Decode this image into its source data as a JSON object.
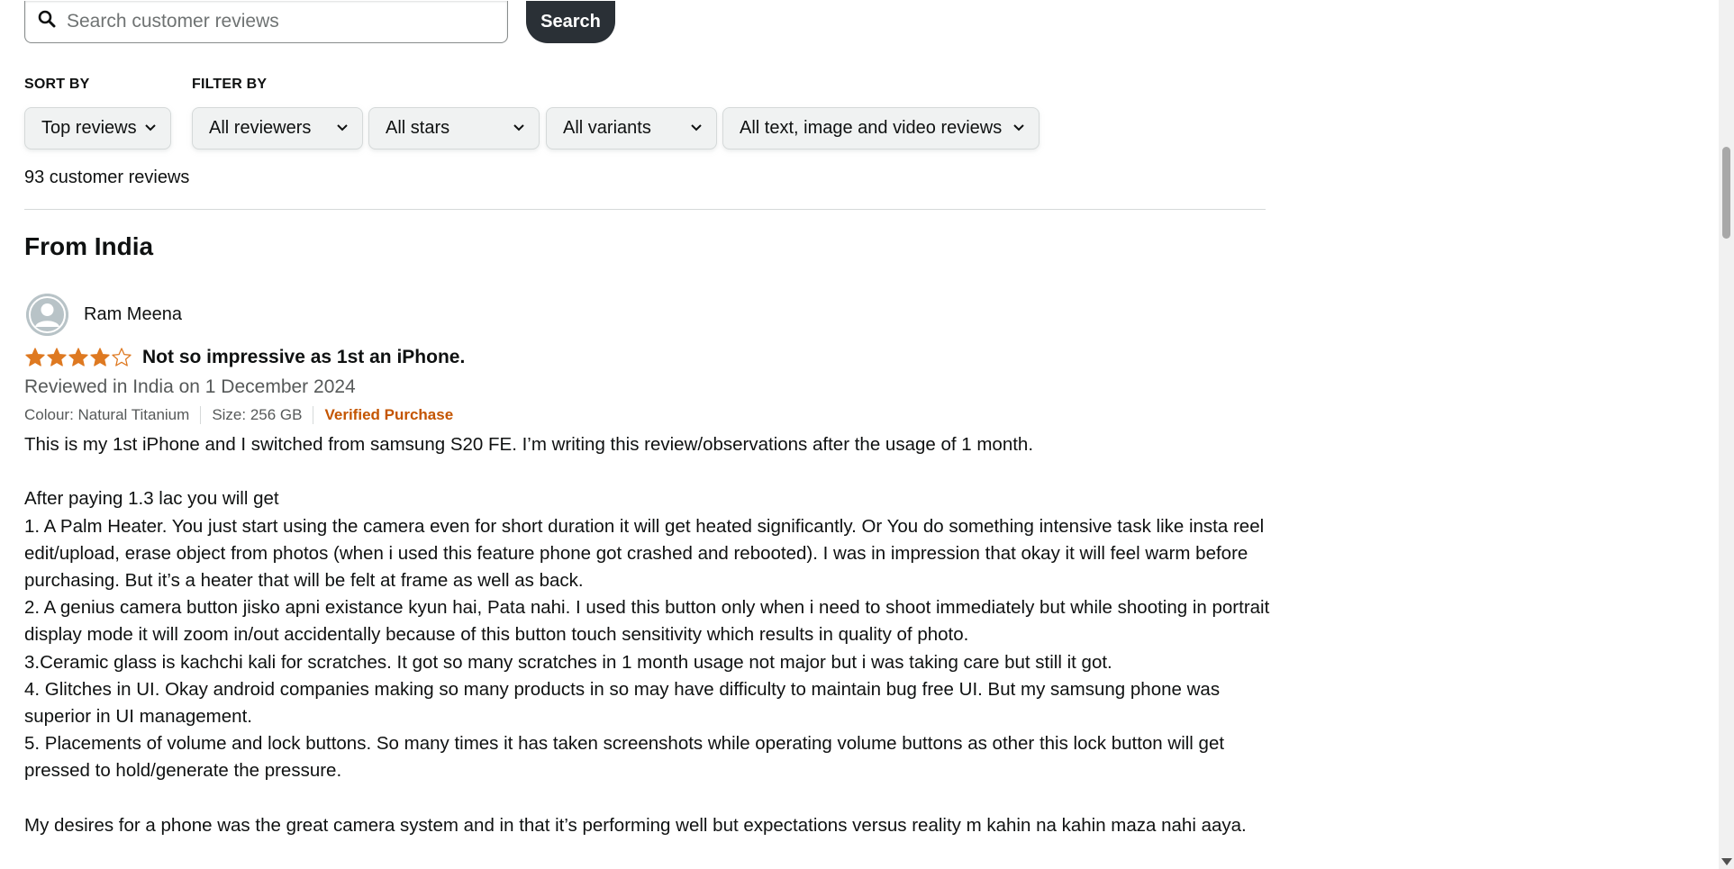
{
  "search": {
    "placeholder": "Search customer reviews",
    "button_label": "Search"
  },
  "sort": {
    "label": "SORT BY",
    "selected": "Top reviews"
  },
  "filter": {
    "label": "FILTER BY",
    "reviewers": "All reviewers",
    "stars": "All stars",
    "variants": "All variants",
    "media": "All text, image and video reviews"
  },
  "review_count": "93 customer reviews",
  "section_title": "From India",
  "review": {
    "reviewer_name": "Ram Meena",
    "rating": 4,
    "rating_max": 5,
    "title": "Not so impressive as 1st an iPhone.",
    "date": "Reviewed in India on 1 December 2024",
    "colour": "Colour: Natural Titanium",
    "size": "Size: 256 GB",
    "verified": "Verified Purchase",
    "body": "This is my 1st iPhone and I switched from samsung S20 FE. I’m writing this review/observations after the usage of 1 month.\n\nAfter paying 1.3 lac you will get\n1. A Palm Heater. You just start using the camera even for short duration it will get heated significantly. Or You do something intensive task like insta reel edit/upload, erase object from photos (when i used this feature phone got crashed and rebooted). I was in impression that okay it will feel warm before purchasing. But it’s a heater that will be felt at frame as well as back.\n2. A genius camera button jisko apni existance kyun hai, Pata nahi. I used this button only when i need to shoot immediately but while shooting in portrait display mode it will zoom in/out accidentally because of this button touch sensitivity which results in quality of photo.\n3.Ceramic glass is kachchi kali for scratches. It got so many scratches in 1 month usage not major but i was taking care but still it got.\n4. Glitches in UI. Okay android companies making so many products in so may have difficulty to maintain bug free UI. But my samsung phone was superior in UI management.\n5. Placements of volume and lock buttons. So many times it has taken screenshots while operating volume buttons as other this lock button will get pressed to hold/generate the pressure.\n\nMy desires for a phone was the great camera system and in that it’s performing well but expectations versus reality m kahin na kahin maza nahi aaya."
  },
  "colors": {
    "star": "#de7921",
    "verified": "#c45500",
    "search_button": "#2a3036"
  },
  "icons": {
    "search": "search-icon",
    "dropdown": "chevron-down-icon",
    "avatar": "user-avatar-icon",
    "star": "star-icon"
  }
}
